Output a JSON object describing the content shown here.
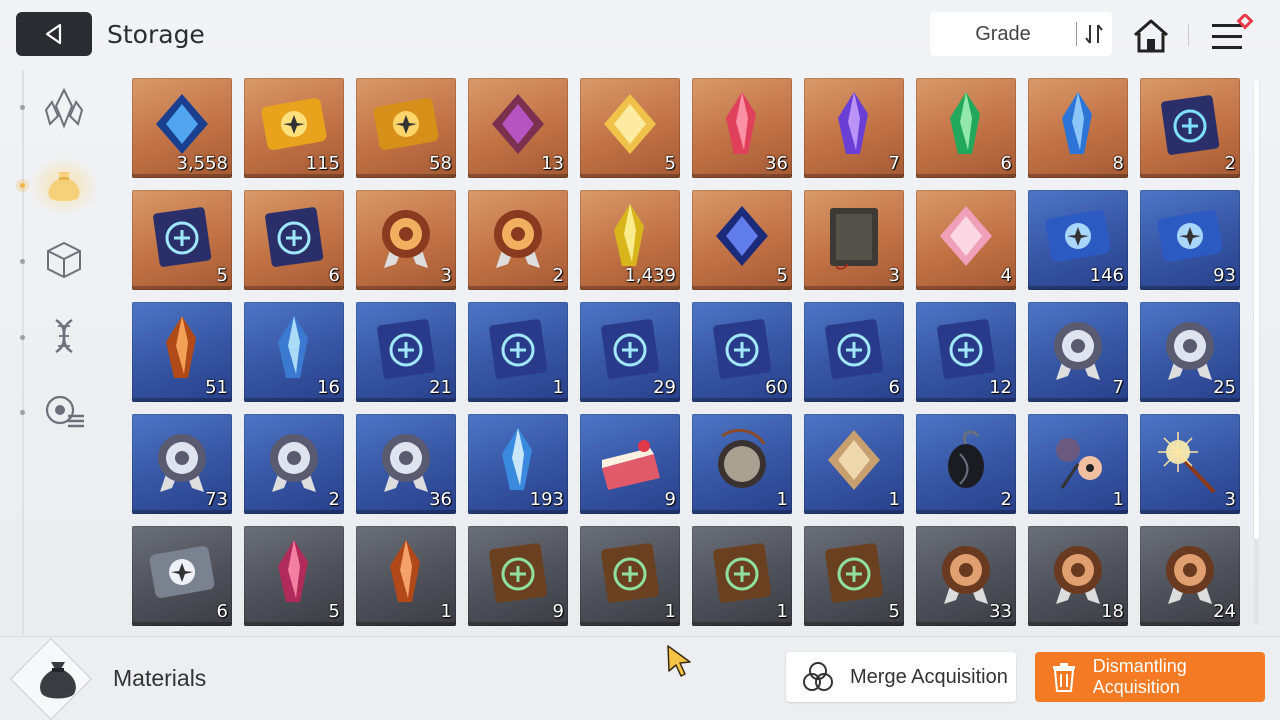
{
  "header": {
    "title": "Storage",
    "sort_label": "Grade"
  },
  "sidebar": {
    "items": [
      {
        "icon": "crystal-icon",
        "active": false
      },
      {
        "icon": "pouch-icon",
        "active": true
      },
      {
        "icon": "cube-icon",
        "active": false
      },
      {
        "icon": "dna-icon",
        "active": false
      },
      {
        "icon": "gear-list-icon",
        "active": false
      }
    ]
  },
  "items": [
    {
      "icon": "blue-spirit-orb",
      "grade": "orange",
      "qty": "3,558"
    },
    {
      "icon": "gold-portrait-ticket",
      "grade": "orange",
      "qty": "115"
    },
    {
      "icon": "gold-star-ticket",
      "grade": "orange",
      "qty": "58"
    },
    {
      "icon": "purple-eye-core",
      "grade": "orange",
      "qty": "13"
    },
    {
      "icon": "golden-feather",
      "grade": "orange",
      "qty": "5"
    },
    {
      "icon": "red-crystal",
      "grade": "orange",
      "qty": "36"
    },
    {
      "icon": "purple-crystal",
      "grade": "orange",
      "qty": "7"
    },
    {
      "icon": "green-crystal",
      "grade": "orange",
      "qty": "6"
    },
    {
      "icon": "blue-crystal",
      "grade": "orange",
      "qty": "8"
    },
    {
      "icon": "eye-skill-book",
      "grade": "orange",
      "qty": "2"
    },
    {
      "icon": "wing-skill-book",
      "grade": "orange",
      "qty": "5"
    },
    {
      "icon": "bolt-skill-book",
      "grade": "orange",
      "qty": "6"
    },
    {
      "icon": "shield-medal",
      "grade": "orange",
      "qty": "3"
    },
    {
      "icon": "target-medal",
      "grade": "orange",
      "qty": "2"
    },
    {
      "icon": "yellow-shards",
      "grade": "orange",
      "qty": "1,439"
    },
    {
      "icon": "dark-cube-gem",
      "grade": "orange",
      "qty": "5"
    },
    {
      "icon": "leather-journal",
      "grade": "orange",
      "qty": "3"
    },
    {
      "icon": "pink-guitar-pick",
      "grade": "orange",
      "qty": "4"
    },
    {
      "icon": "blue-portrait-ticket",
      "grade": "blue",
      "qty": "146"
    },
    {
      "icon": "blue-star-ticket",
      "grade": "blue",
      "qty": "93"
    },
    {
      "icon": "amber-shard",
      "grade": "blue",
      "qty": "51"
    },
    {
      "icon": "ice-shard",
      "grade": "blue",
      "qty": "16"
    },
    {
      "icon": "swords-skill-book",
      "grade": "blue",
      "qty": "21"
    },
    {
      "icon": "shield-skill-book",
      "grade": "blue",
      "qty": "1"
    },
    {
      "icon": "eye-skill-book-blue",
      "grade": "blue",
      "qty": "29"
    },
    {
      "icon": "wing-skill-book-blue",
      "grade": "blue",
      "qty": "60"
    },
    {
      "icon": "bolt-skill-book-blue",
      "grade": "blue",
      "qty": "6"
    },
    {
      "icon": "target-skill-book-blue",
      "grade": "blue",
      "qty": "12"
    },
    {
      "icon": "swords-medal-silver",
      "grade": "blue",
      "qty": "7"
    },
    {
      "icon": "target-medal-silver",
      "grade": "blue",
      "qty": "25"
    },
    {
      "icon": "wing-medal-silver",
      "grade": "blue",
      "qty": "73"
    },
    {
      "icon": "bolt-medal-silver",
      "grade": "blue",
      "qty": "2"
    },
    {
      "icon": "circle-medal-silver",
      "grade": "blue",
      "qty": "36"
    },
    {
      "icon": "ice-crystal-burst",
      "grade": "blue",
      "qty": "193"
    },
    {
      "icon": "strawberry-cake",
      "grade": "blue",
      "qty": "9"
    },
    {
      "icon": "pocket-watch",
      "grade": "blue",
      "qty": "1"
    },
    {
      "icon": "gold-tag",
      "grade": "blue",
      "qty": "1"
    },
    {
      "icon": "black-beetle",
      "grade": "blue",
      "qty": "2"
    },
    {
      "icon": "flower-bouquet",
      "grade": "blue",
      "qty": "1"
    },
    {
      "icon": "sparkler",
      "grade": "blue",
      "qty": "3"
    },
    {
      "icon": "silver-star-ticket",
      "grade": "gray",
      "qty": "6"
    },
    {
      "icon": "pink-shard",
      "grade": "gray",
      "qty": "5"
    },
    {
      "icon": "orange-shard",
      "grade": "gray",
      "qty": "1"
    },
    {
      "icon": "swords-skill-book-bronze",
      "grade": "gray",
      "qty": "9"
    },
    {
      "icon": "wing-skill-book-bronze",
      "grade": "gray",
      "qty": "1"
    },
    {
      "icon": "bolt-skill-book-bronze",
      "grade": "gray",
      "qty": "1"
    },
    {
      "icon": "target-skill-book-bronze",
      "grade": "gray",
      "qty": "5"
    },
    {
      "icon": "swords-medal-bronze",
      "grade": "gray",
      "qty": "33"
    },
    {
      "icon": "shield-medal-bronze",
      "grade": "gray",
      "qty": "18"
    },
    {
      "icon": "target-medal-bronze",
      "grade": "gray",
      "qty": "24"
    }
  ],
  "footer": {
    "category_label": "Materials",
    "merge_label": "Merge Acquisition",
    "dismantle_label": "Dismantling Acquisition"
  },
  "colors": {
    "accent": "#f47b23",
    "grade_orange": "#c17245",
    "grade_blue": "#3655a3",
    "grade_gray": "#4e5159"
  }
}
